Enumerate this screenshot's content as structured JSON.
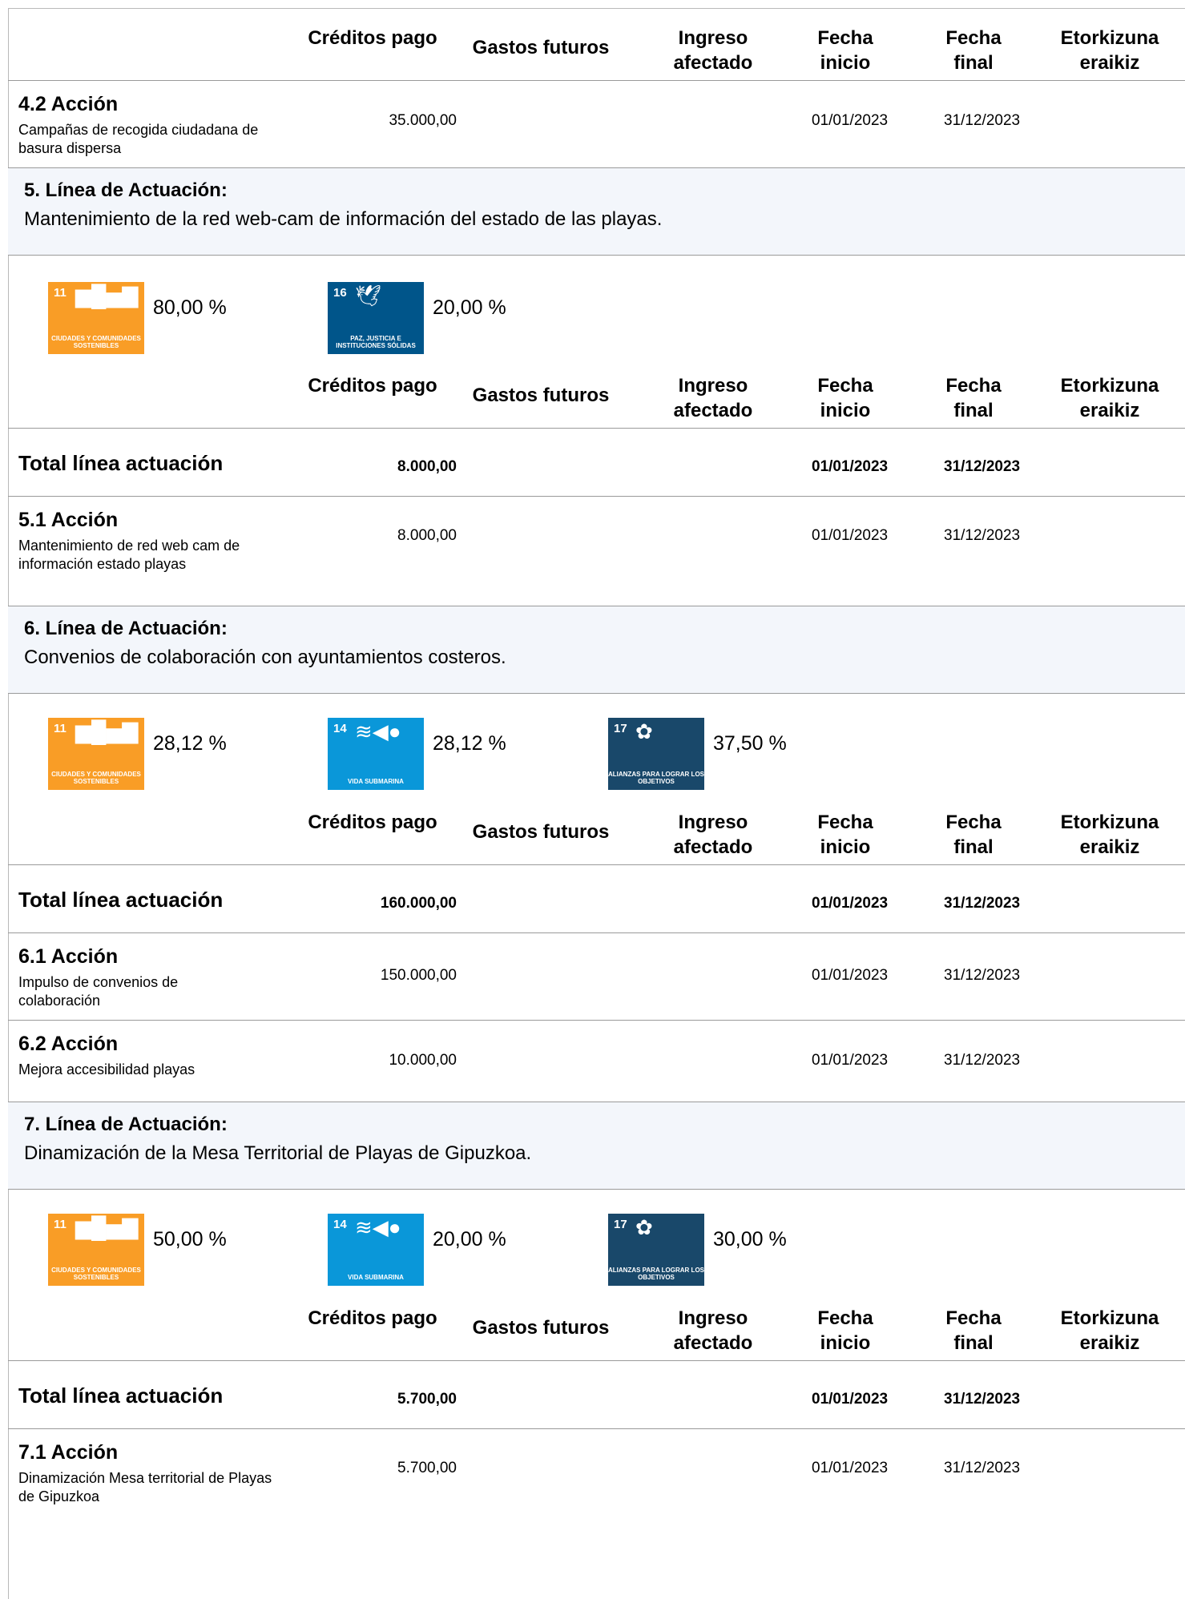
{
  "headers": {
    "creditos": "Créditos pago",
    "gastos": "Gastos futuros",
    "ingreso": "Ingreso afectado",
    "fecha_inicio": "Fecha inicio",
    "fecha_final": "Fecha final",
    "etorkizuna": "Etorkizuna eraikiz"
  },
  "total_label": "Total línea actuación",
  "a42": {
    "title": "4.2 Acción",
    "desc": "Campañas de recogida ciudadana de basura dispersa",
    "creditos": "35.000,00",
    "inicio": "01/01/2023",
    "final": "31/12/2023"
  },
  "l5": {
    "title": "5. Línea de Actuación:",
    "desc": "Mantenimiento de la red web-cam de información del estado de las playas.",
    "ods": [
      {
        "num": "11",
        "icon": "city-icon",
        "label": "Ciudades y comunidades sostenibles",
        "color": "#f99d26",
        "pct": "80,00 %"
      },
      {
        "num": "16",
        "icon": "dove-icon",
        "label": "Paz, justicia e instituciones sólidas",
        "color": "#00558a",
        "pct": "20,00 %"
      }
    ],
    "total": {
      "creditos": "8.000,00",
      "inicio": "01/01/2023",
      "final": "31/12/2023"
    },
    "actions": [
      {
        "title": "5.1 Acción",
        "desc": "Mantenimiento de red web cam de información estado playas",
        "creditos": "8.000,00",
        "inicio": "01/01/2023",
        "final": "31/12/2023"
      }
    ]
  },
  "l6": {
    "title": "6. Línea de Actuación:",
    "desc": "Convenios de colaboración con ayuntamientos costeros.",
    "ods": [
      {
        "num": "11",
        "icon": "city-icon",
        "label": "Ciudades y comunidades sostenibles",
        "color": "#f99d26",
        "pct": "28,12 %"
      },
      {
        "num": "14",
        "icon": "fish-icon",
        "label": "Vida submarina",
        "color": "#0a97d9",
        "pct": "28,12 %"
      },
      {
        "num": "17",
        "icon": "flower-icon",
        "label": "Alianzas para lograr los objetivos",
        "color": "#19486a",
        "pct": "37,50 %"
      }
    ],
    "total": {
      "creditos": "160.000,00",
      "inicio": "01/01/2023",
      "final": "31/12/2023"
    },
    "actions": [
      {
        "title": "6.1 Acción",
        "desc": "Impulso de convenios de colaboración",
        "creditos": "150.000,00",
        "inicio": "01/01/2023",
        "final": "31/12/2023"
      },
      {
        "title": "6.2 Acción",
        "desc": "Mejora accesibilidad playas",
        "creditos": "10.000,00",
        "inicio": "01/01/2023",
        "final": "31/12/2023"
      }
    ]
  },
  "l7": {
    "title": "7. Línea de Actuación:",
    "desc": "Dinamización de la Mesa Territorial de Playas de Gipuzkoa.",
    "ods": [
      {
        "num": "11",
        "icon": "city-icon",
        "label": "Ciudades y comunidades sostenibles",
        "color": "#f99d26",
        "pct": "50,00 %"
      },
      {
        "num": "14",
        "icon": "fish-icon",
        "label": "Vida submarina",
        "color": "#0a97d9",
        "pct": "20,00 %"
      },
      {
        "num": "17",
        "icon": "flower-icon",
        "label": "Alianzas para lograr los objetivos",
        "color": "#19486a",
        "pct": "30,00 %"
      }
    ],
    "total": {
      "creditos": "5.700,00",
      "inicio": "01/01/2023",
      "final": "31/12/2023"
    },
    "actions": [
      {
        "title": "7.1 Acción",
        "desc": "Dinamización Mesa territorial de Playas de Gipuzkoa",
        "creditos": "5.700,00",
        "inicio": "01/01/2023",
        "final": "31/12/2023"
      }
    ]
  }
}
